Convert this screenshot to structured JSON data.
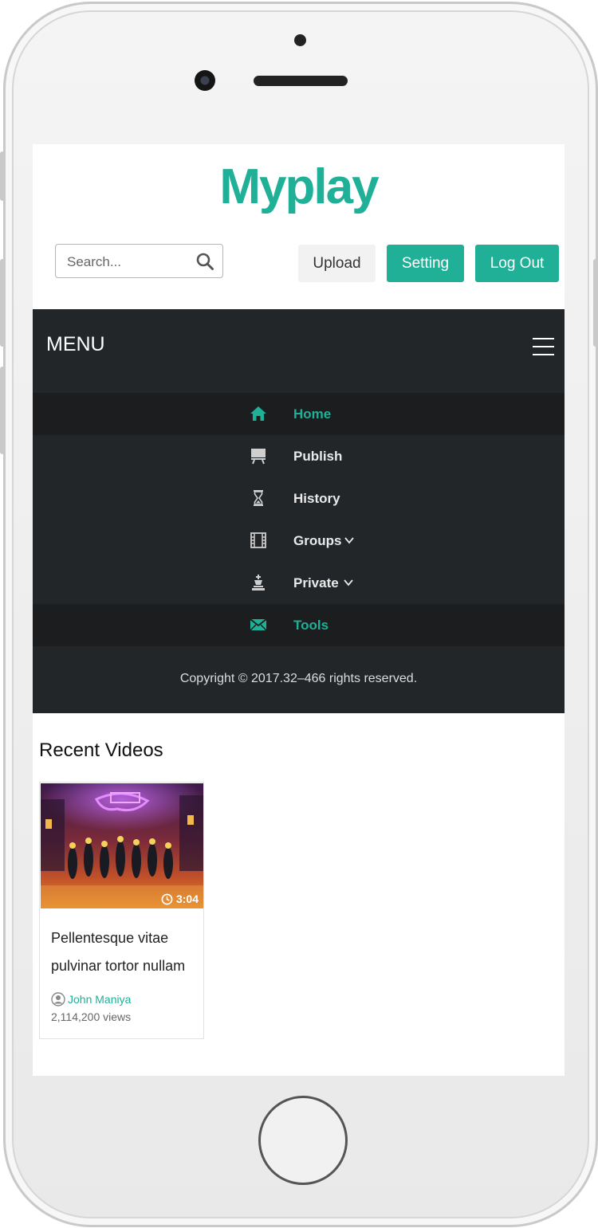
{
  "app": {
    "logo": "Myplay"
  },
  "header": {
    "search_placeholder": "Search...",
    "upload_label": "Upload",
    "setting_label": "Setting",
    "logout_label": "Log Out"
  },
  "menu": {
    "title": "MENU",
    "items": [
      {
        "label": "Home",
        "icon": "home-icon",
        "active": true,
        "teal": true
      },
      {
        "label": "Publish",
        "icon": "easel-icon"
      },
      {
        "label": "History",
        "icon": "hourglass-icon"
      },
      {
        "label": "Groups",
        "icon": "film-icon",
        "dropdown": true
      },
      {
        "label": "Private",
        "icon": "chess-king-icon",
        "dropdown": true
      },
      {
        "label": "Tools",
        "icon": "envelope-icon",
        "active": true,
        "teal": true
      }
    ],
    "copyright": "Copyright © 2017.32–466 rights reserved."
  },
  "recent": {
    "title": "Recent Videos",
    "videos": [
      {
        "title": "Pellentesque vitae pulvinar tortor nullam",
        "duration": "3:04",
        "author": "John Maniya",
        "views": "2,114,200 views"
      }
    ]
  },
  "colors": {
    "accent": "#1fb097",
    "menu_bg": "#232628",
    "menu_active_bg": "#1b1d1e"
  }
}
